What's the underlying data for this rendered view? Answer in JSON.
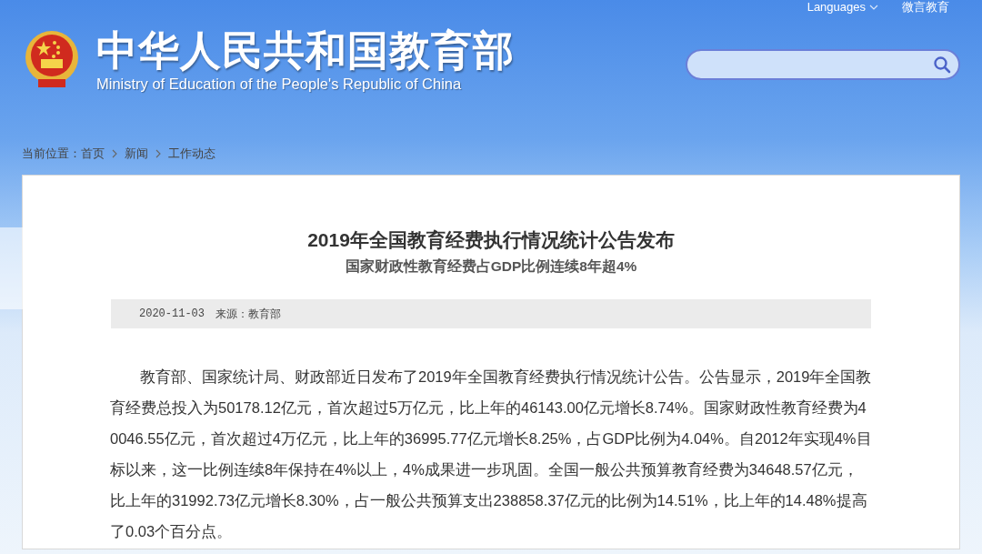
{
  "header": {
    "site_title": "中华人民共和国教育部",
    "site_subtitle": "Ministry of Education of the People's Republic of China",
    "top_links": [
      {
        "label": "Languages",
        "kind": "dropdown"
      },
      {
        "label": "微言教育",
        "kind": "link"
      }
    ]
  },
  "breadcrumb": {
    "label": "当前位置：",
    "items": [
      "首页",
      "新闻",
      "工作动态"
    ]
  },
  "article": {
    "title": "2019年全国教育经费执行情况统计公告发布",
    "subtitle": "国家财政性教育经费占GDP比例连续8年超4%",
    "date": "2020-11-03",
    "source": "来源：教育部",
    "paragraphs": [
      "教育部、国家统计局、财政部近日发布了2019年全国教育经费执行情况统计公告。公告显示，2019年全国教育经费总投入为50178.12亿元，首次超过5万亿元，比上年的46143.00亿元增长8.74%。国家财政性教育经费为40046.55亿元，首次超过4万亿元，比上年的36995.77亿元增长8.25%，占GDP比例为4.04%。自2012年实现4%目标以来，这一比例连续8年保持在4%以上，4%成果进一步巩固。全国一般公共预算教育经费为34648.57亿元，比上年的31992.73亿元增长8.30%，占一般公共预算支出238858.37亿元的比例为14.51%，比上年的14.48%提高了0.03个百分点。"
    ]
  }
}
